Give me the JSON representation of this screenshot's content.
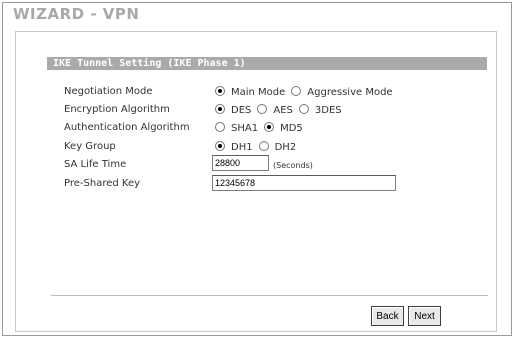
{
  "page": {
    "title": "WIZARD - VPN"
  },
  "section": {
    "title": "IKE Tunnel Setting (IKE Phase 1)"
  },
  "fields": {
    "negotiation_mode": {
      "label": "Negotiation Mode",
      "options": [
        "Main Mode",
        "Aggressive Mode"
      ],
      "selected": "Main Mode"
    },
    "encryption_algorithm": {
      "label": "Encryption Algorithm",
      "options": [
        "DES",
        "AES",
        "3DES"
      ],
      "selected": "DES"
    },
    "authentication_algorithm": {
      "label": "Authentication Algorithm",
      "options": [
        "SHA1",
        "MD5"
      ],
      "selected": "MD5"
    },
    "key_group": {
      "label": "Key Group",
      "options": [
        "DH1",
        "DH2"
      ],
      "selected": "DH1"
    },
    "sa_life_time": {
      "label": "SA Life Time",
      "value": "28800",
      "unit": "(Seconds)"
    },
    "pre_shared_key": {
      "label": "Pre-Shared Key",
      "value": "12345678"
    }
  },
  "buttons": {
    "back": "Back",
    "next": "Next"
  }
}
